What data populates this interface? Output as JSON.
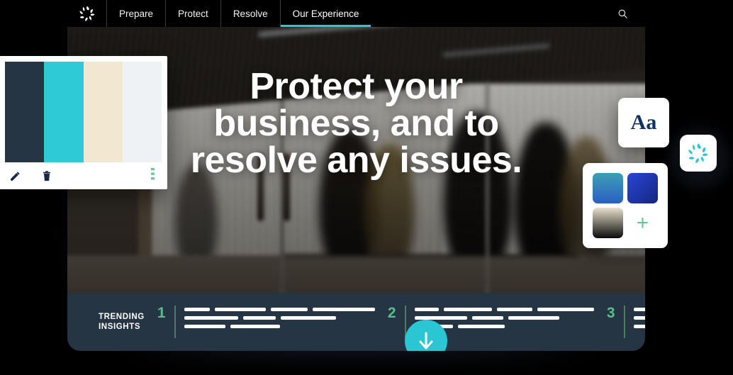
{
  "nav": {
    "logo_icon": "aperture-logo-icon",
    "items": [
      {
        "label": "Prepare",
        "active": false
      },
      {
        "label": "Protect",
        "active": false
      },
      {
        "label": "Resolve",
        "active": false
      },
      {
        "label": "Our Experience",
        "active": true
      }
    ],
    "search_icon": "search-icon",
    "active_underline_color": "#2bc6d4"
  },
  "hero": {
    "headline_line1": "Protect your",
    "headline_line2": "business, and to",
    "headline_line3": "resolve any issues."
  },
  "insights": {
    "label_line1": "TRENDING",
    "label_line2": "INSIGHTS",
    "number_color": "#57c08a",
    "items": [
      {
        "number": "1",
        "rows": [
          [
            36,
            72,
            52,
            88
          ],
          [
            76,
            46,
            78
          ],
          [
            58,
            70
          ]
        ]
      },
      {
        "number": "2",
        "rows": [
          [
            34,
            68,
            50,
            80
          ],
          [
            74,
            44,
            72
          ],
          [
            54,
            66
          ]
        ]
      },
      {
        "number": "3",
        "rows": [
          [
            32,
            66,
            48,
            76
          ],
          [
            70,
            42,
            68
          ],
          [
            52,
            62
          ]
        ]
      }
    ]
  },
  "scroll_button": {
    "icon": "arrow-down-icon",
    "color": "#2bc6d4"
  },
  "palette_card": {
    "swatches": [
      "#263544",
      "#2FCBD4",
      "#F2E8D2",
      "#EFF2F4"
    ],
    "edit_icon": "pencil-icon",
    "delete_icon": "trash-icon",
    "more_icon": "more-vertical-icon",
    "icon_color": "#16284a",
    "more_color": "#63c995"
  },
  "type_card": {
    "sample_text": "Aa",
    "color": "#12315e"
  },
  "gradient_card": {
    "swatches": [
      {
        "name": "teal-blue-gradient",
        "from": "#3e9fb4",
        "to": "#2a5fc4"
      },
      {
        "name": "blue-gradient",
        "from": "#2746d8",
        "to": "#16267e"
      },
      {
        "name": "cream-black-gradient",
        "from": "#e8e0cc",
        "to": "#0b0b0b"
      }
    ],
    "add_label": "+",
    "add_color": "#63c995"
  },
  "brand_badge": {
    "icon": "aperture-logo-icon",
    "color": "#2bc6d4"
  }
}
